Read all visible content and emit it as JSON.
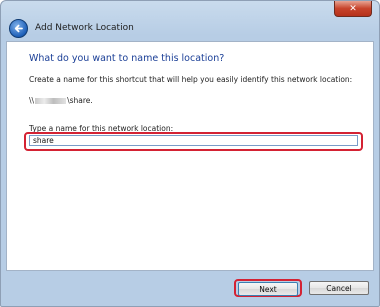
{
  "window": {
    "title": "Add Network Location",
    "close_label": "✕"
  },
  "main": {
    "heading": "What do you want to name this location?",
    "instruction": "Create a name for this shortcut that will help you easily identify this network location:",
    "path_prefix": "\\\\",
    "path_suffix": "\\share.",
    "field_label": "Type a name for this network location:",
    "name_value": "share"
  },
  "buttons": {
    "next": "Next",
    "cancel": "Cancel"
  },
  "icons": {
    "back": "back-arrow-icon",
    "close": "close-icon"
  },
  "colors": {
    "heading": "#1a3e96",
    "highlight": "#d42233",
    "back_button": "#1d5fb8",
    "close_button": "#c7432b"
  }
}
